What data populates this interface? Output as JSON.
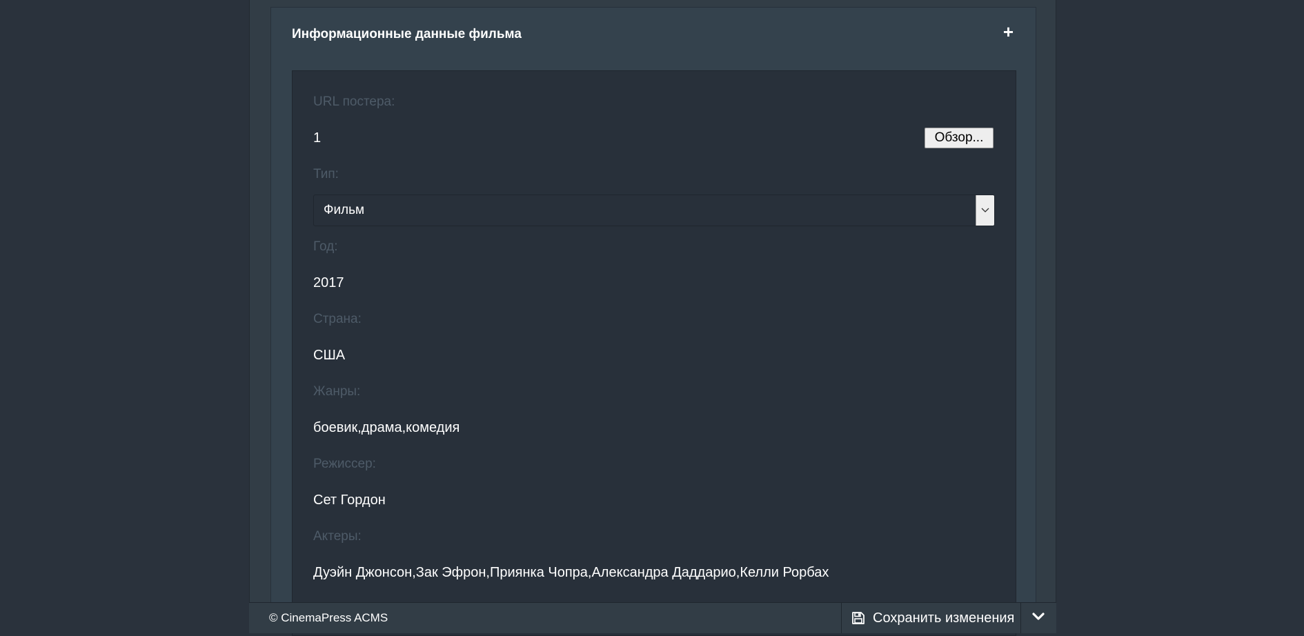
{
  "panel": {
    "title": "Информационные данные фильма",
    "toggle_icon": "plus-icon"
  },
  "fields": {
    "poster": {
      "label": "URL постера:",
      "value": "1",
      "browse_label": "Обзор..."
    },
    "type": {
      "label": "Тип:",
      "value": "Фильм"
    },
    "year": {
      "label": "Год:",
      "value": "2017"
    },
    "country": {
      "label": "Страна:",
      "value": "США"
    },
    "genres": {
      "label": "Жанры:",
      "value": "боевик,драма,комедия"
    },
    "director": {
      "label": "Режиссер:",
      "value": "Сет Гордон"
    },
    "actors": {
      "label": "Актеры:",
      "value": "Дуэйн Джонсон,Зак Эфрон,Приянка Чопра,Александра Даддарио,Келли Рорбах"
    }
  },
  "footer": {
    "copyright": "© CinemaPress ACMS",
    "save_label": "Сохранить изменения",
    "save_icon": "floppy-disk-icon",
    "expand_icon": "chevron-down-icon"
  },
  "colors": {
    "background": "#2a323c",
    "panel": "#34424d",
    "panel_body": "#28303a",
    "label": "#4e5b68",
    "text": "#ffffff"
  }
}
